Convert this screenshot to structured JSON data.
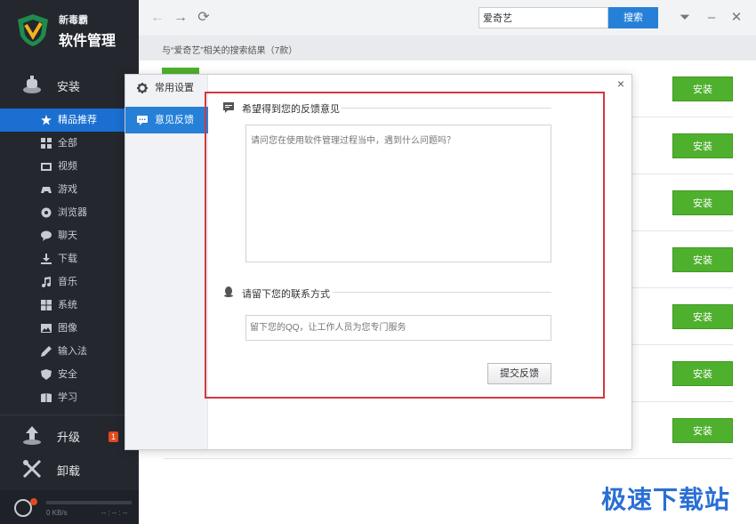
{
  "app": {
    "brand_small": "新毒霸",
    "brand_big": "软件管理"
  },
  "sidebar": {
    "install_label": "安装",
    "categories": [
      {
        "label": "精品推荐",
        "icon": "star-icon",
        "active": true
      },
      {
        "label": "全部",
        "icon": "grid-icon"
      },
      {
        "label": "视频",
        "icon": "video-icon"
      },
      {
        "label": "游戏",
        "icon": "gamepad-icon"
      },
      {
        "label": "浏览器",
        "icon": "globe-icon"
      },
      {
        "label": "聊天",
        "icon": "chat-icon"
      },
      {
        "label": "下载",
        "icon": "download-icon"
      },
      {
        "label": "音乐",
        "icon": "music-icon"
      },
      {
        "label": "系统",
        "icon": "windows-icon"
      },
      {
        "label": "图像",
        "icon": "image-icon"
      },
      {
        "label": "输入法",
        "icon": "pen-icon"
      },
      {
        "label": "安全",
        "icon": "shield-icon"
      },
      {
        "label": "学习",
        "icon": "book-icon"
      }
    ],
    "upgrade_label": "升级",
    "upgrade_badge": "1",
    "uninstall_label": "卸载",
    "download_speed": "0 KB/s",
    "download_time": "-- : -- : --"
  },
  "topbar": {
    "search_value": "爱奇艺",
    "search_button": "搜索"
  },
  "results": {
    "summary": "与“爱奇艺”相关的搜索结果（7款）",
    "install_label": "安装",
    "rows": 7
  },
  "dialog": {
    "tabs": [
      {
        "label": "常用设置",
        "icon": "gear-icon"
      },
      {
        "label": "意见反馈",
        "icon": "comment-icon",
        "active": true
      }
    ],
    "close": "×",
    "feedback_title": "希望得到您的反馈意见",
    "feedback_placeholder": "请问您在使用软件管理过程当中，遇到什么问题吗？",
    "contact_title": "请留下您的联系方式",
    "contact_placeholder": "留下您的QQ，让工作人员为您专门服务",
    "submit": "提交反馈"
  },
  "watermark": "极速下载站",
  "colors": {
    "sidebar_bg": "#24272e",
    "accent_blue": "#2680d8",
    "install_green": "#4fb02d",
    "highlight_red": "#d3383d"
  }
}
